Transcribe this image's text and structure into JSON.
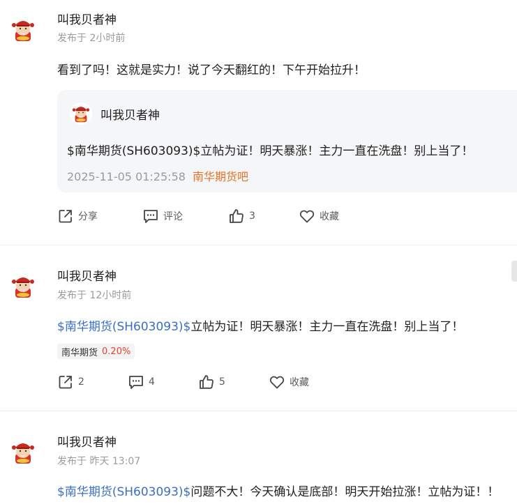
{
  "posts": [
    {
      "author": "叫我贝者神",
      "time": "发布于 2小时前",
      "text": "看到了吗！这就是实力！说了今天翻红的！下午开始拉升！",
      "quote": {
        "author": "叫我贝者神",
        "link": "$南华期货(SH603093)$",
        "text": "立帖为证！明天暴涨！主力一直在洗盘！别上当了！",
        "time": "2025-11-05 01:25:58",
        "tag": "南华期货吧"
      },
      "actions": {
        "share": "分享",
        "comment": "评论",
        "like": "3",
        "fav": "收藏"
      }
    },
    {
      "author": "叫我贝者神",
      "time": "发布于 12小时前",
      "link": "$南华期货(SH603093)$",
      "text": "立帖为证！明天暴涨！主力一直在洗盘！别上当了！",
      "stock": {
        "name": "南华期货",
        "change": "0.20%"
      },
      "actions": {
        "share": "2",
        "comment": "4",
        "like": "5",
        "fav": "收藏"
      }
    },
    {
      "author": "叫我贝者神",
      "time": "发布于 昨天 13:07",
      "link": "$南华期货(SH603093)$",
      "text": "问题不大！今天确认是底部！明天开始拉涨！立帖为证！！"
    }
  ],
  "colors": {
    "link": "#3a6fc6",
    "tag": "#e2742a",
    "up": "#e0422a"
  },
  "icons": [
    "avatar-god-of-wealth",
    "share-icon",
    "comment-icon",
    "thumbs-up-icon",
    "heart-icon"
  ]
}
